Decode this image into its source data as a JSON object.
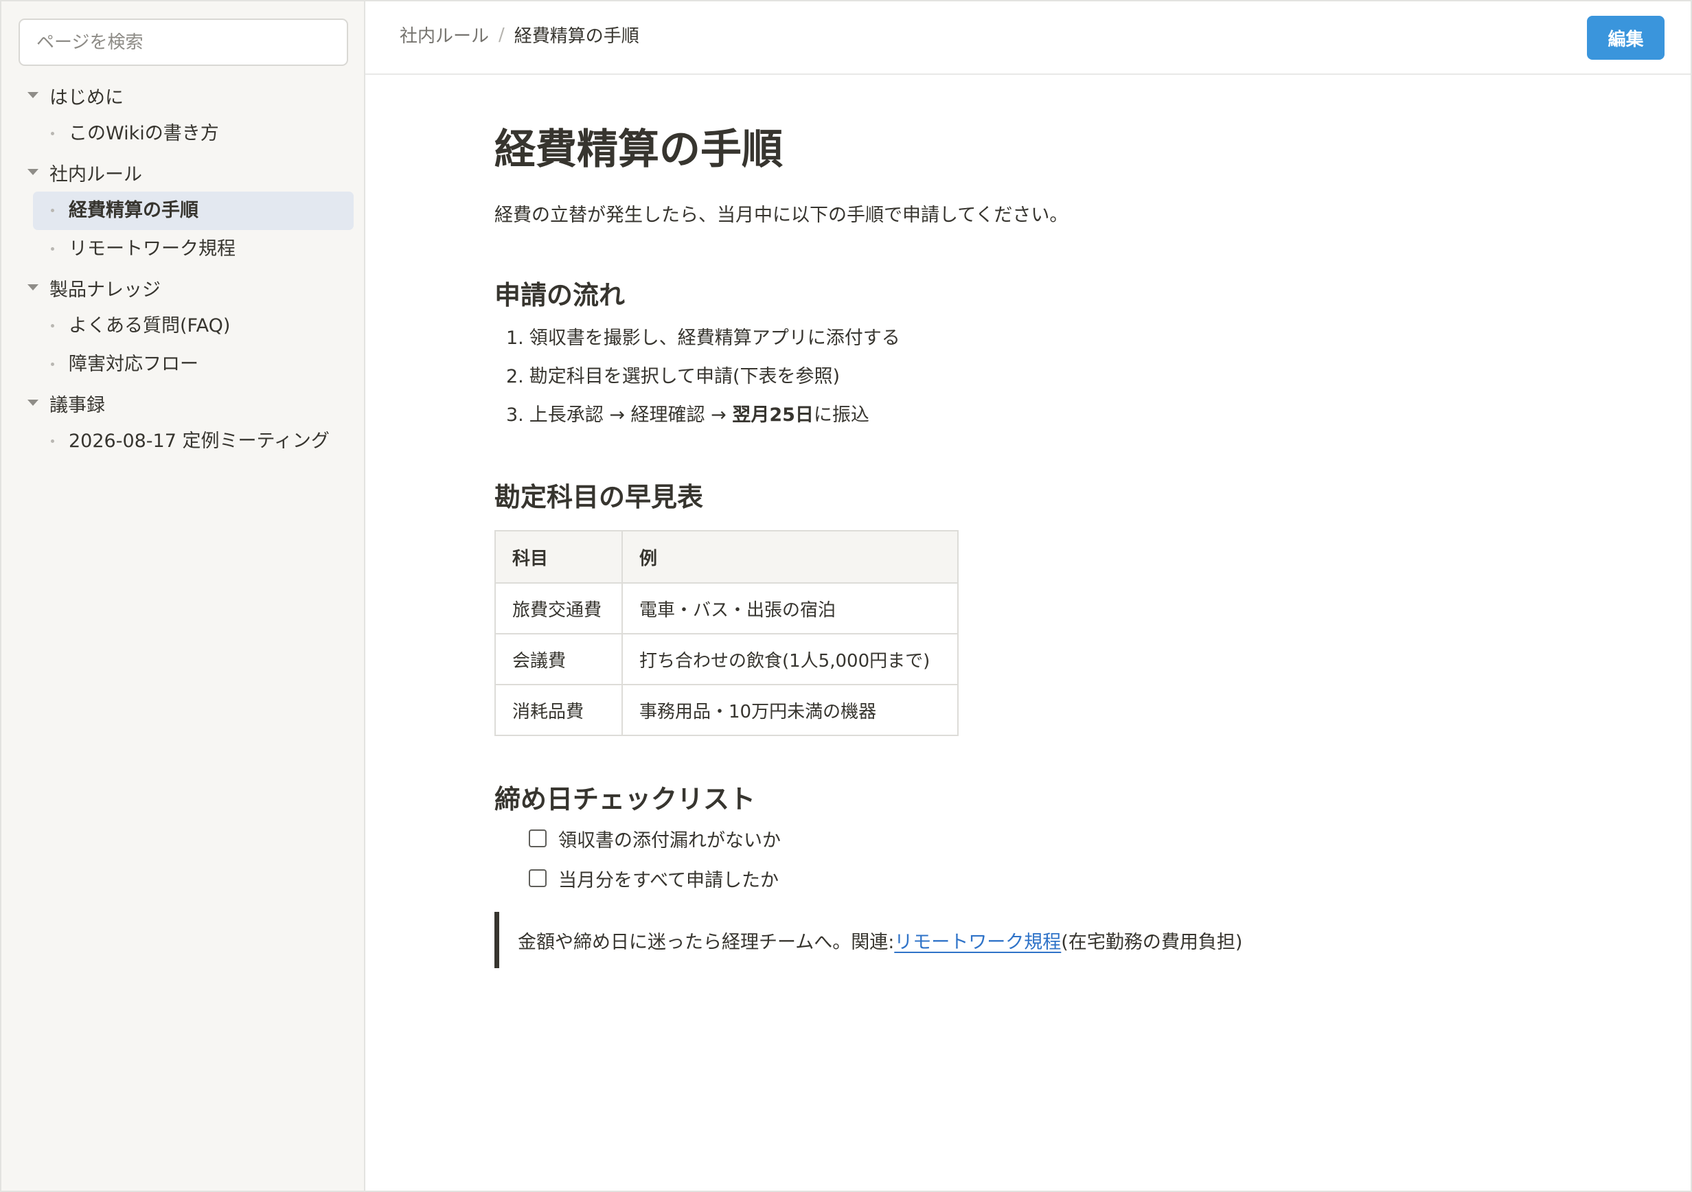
{
  "sidebar": {
    "search_placeholder": "ページを検索",
    "groups": [
      {
        "label": "はじめに",
        "items": [
          {
            "label": "このWikiの書き方",
            "active": false
          }
        ]
      },
      {
        "label": "社内ルール",
        "items": [
          {
            "label": "経費精算の手順",
            "active": true
          },
          {
            "label": "リモートワーク規程",
            "active": false
          }
        ]
      },
      {
        "label": "製品ナレッジ",
        "items": [
          {
            "label": "よくある質問(FAQ)",
            "active": false
          },
          {
            "label": "障害対応フロー",
            "active": false
          }
        ]
      },
      {
        "label": "議事録",
        "items": [
          {
            "label": "2026-08-17 定例ミーティング",
            "active": false
          }
        ]
      }
    ]
  },
  "header": {
    "breadcrumb": {
      "parent": "社内ルール",
      "separator": "/",
      "current": "経費精算の手順"
    },
    "edit_label": "編集",
    "accent_color": "#3a95dc"
  },
  "page": {
    "title": "経費精算の手順",
    "intro": "経費の立替が発生したら、当月中に以下の手順で申請してください。",
    "flow_heading": "申請の流れ",
    "steps": [
      {
        "num": "1.",
        "text": "領収書を撮影し、経費精算アプリに添付する"
      },
      {
        "num": "2.",
        "text": "勘定科目を選択して申請(下表を参照)"
      },
      {
        "num": "3.",
        "pre": "上長承認 → 経理確認 → ",
        "bold": "翌月25日",
        "post": "に振込"
      }
    ],
    "table_heading": "勘定科目の早見表",
    "table": {
      "headers": [
        "科目",
        "例"
      ],
      "rows": [
        [
          "旅費交通費",
          "電車・バス・出張の宿泊"
        ],
        [
          "会議費",
          "打ち合わせの飲食(1人5,000円まで)"
        ],
        [
          "消耗品費",
          "事務用品・10万円未満の機器"
        ]
      ]
    },
    "checklist_heading": "締め日チェックリスト",
    "checklist": [
      {
        "label": "領収書の添付漏れがないか",
        "checked": false
      },
      {
        "label": "当月分をすべて申請したか",
        "checked": false
      }
    ],
    "callout": {
      "prefix": "金額や締め日に迷ったら経理チームへ。関連: ",
      "link": "リモートワーク規程",
      "suffix": "(在宅勤務の費用負担)"
    }
  }
}
